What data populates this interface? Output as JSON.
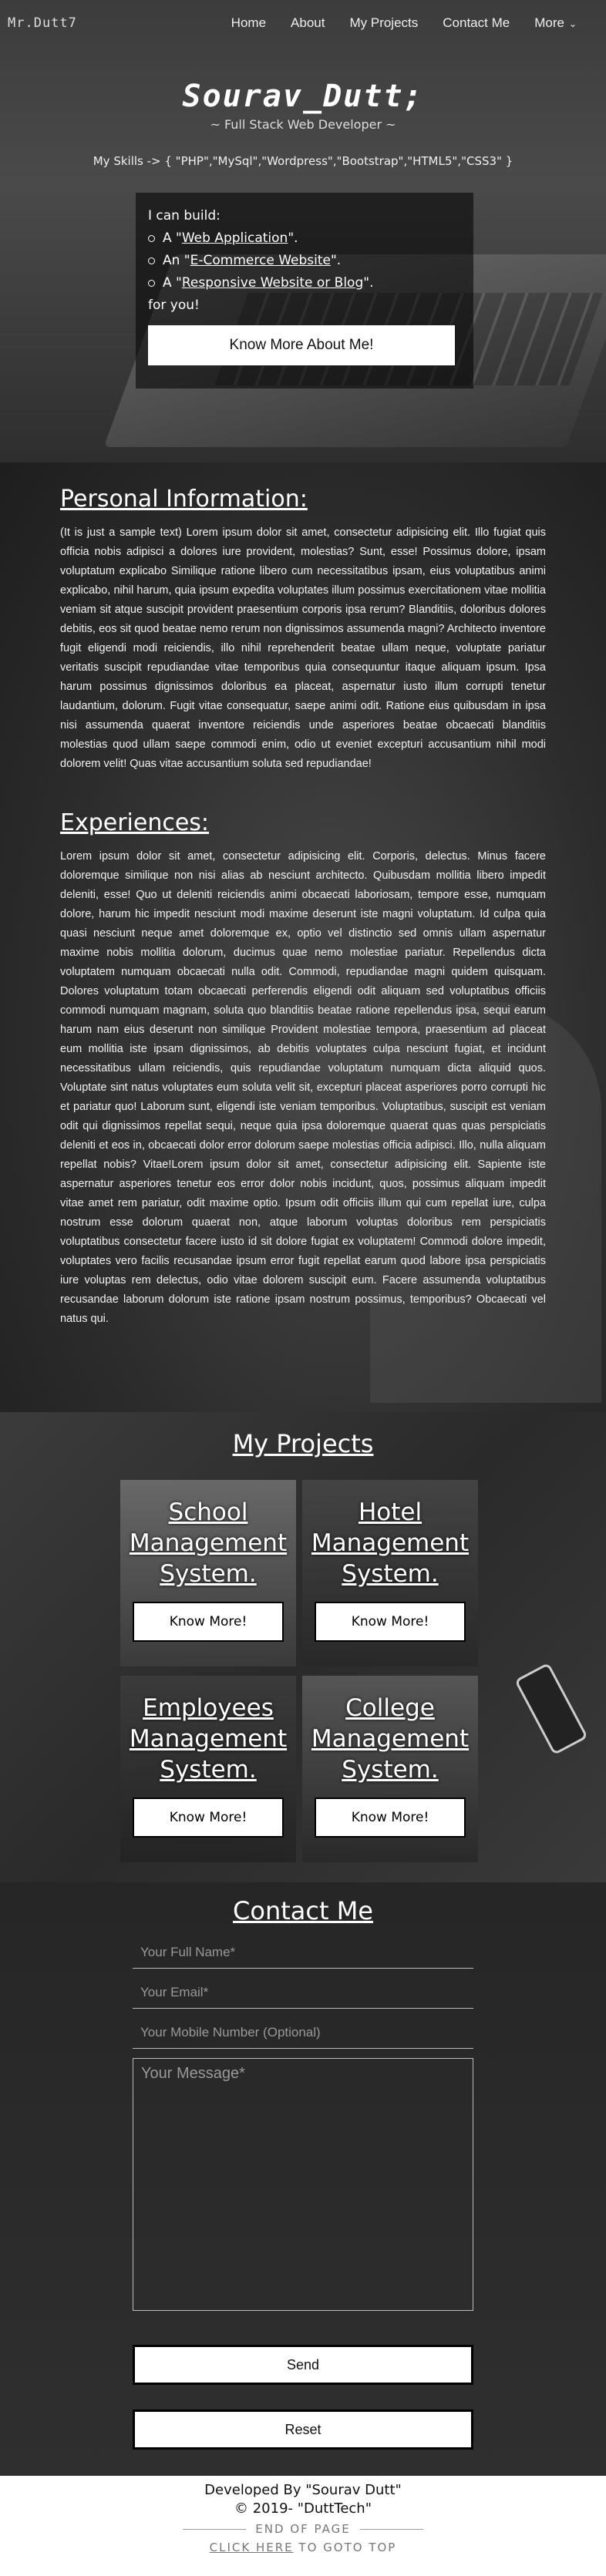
{
  "nav": {
    "brand": "Mr.Dutt7",
    "items": [
      "Home",
      "About",
      "My Projects",
      "Contact Me",
      "More"
    ]
  },
  "hero": {
    "title": "Sourav_Dutt;",
    "subtitle": "~ Full Stack Web Developer ~",
    "skills": "My Skills -> { \"PHP\",\"MySql\",\"Wordpress\",\"Bootstrap\",\"HTML5\",\"CSS3\" }",
    "build_intro": "I can build:",
    "build_items": [
      {
        "prefix": "A \"",
        "link": "Web Application",
        "suffix": "\"."
      },
      {
        "prefix": "An \"",
        "link": "E-Commerce Website",
        "suffix": "\"."
      },
      {
        "prefix": "A \"",
        "link": "Responsive Website or Blog",
        "suffix": "\"."
      }
    ],
    "build_outro": "for you!",
    "button": "Know More About Me!"
  },
  "about": {
    "personal_title": "Personal Information:",
    "personal_text": "(It is just a sample text) Lorem ipsum dolor sit amet, consectetur adipisicing elit. Illo fugiat quis officia nobis adipisci a dolores iure provident, molestias? Sunt, esse! Possimus dolore, ipsam voluptatum explicabo Similique ratione libero cum necessitatibus ipsam, eius voluptatibus animi explicabo, nihil harum, quia ipsum expedita voluptates illum possimus exercitationem vitae mollitia veniam sit atque suscipit provident praesentium corporis ipsa rerum? Blanditiis, doloribus dolores debitis, eos sit quod beatae nemo rerum non dignissimos assumenda magni? Architecto inventore fugit eligendi modi reiciendis, illo nihil reprehenderit beatae ullam neque, voluptate pariatur veritatis suscipit repudiandae vitae temporibus quia consequuntur itaque aliquam ipsum. Ipsa harum possimus dignissimos doloribus ea placeat, aspernatur iusto illum corrupti tenetur laudantium, dolorum. Fugit vitae consequatur, saepe animi odit. Ratione eius quibusdam in ipsa nisi assumenda quaerat inventore reiciendis unde asperiores beatae obcaecati blanditiis molestias quod ullam saepe commodi enim, odio ut eveniet excepturi accusantium nihil modi dolorem velit! Quas vitae accusantium soluta sed repudiandae!",
    "experience_title": "Experiences:",
    "experience_text": "Lorem ipsum dolor sit amet, consectetur adipisicing elit. Corporis, delectus. Minus facere doloremque similique non nisi alias ab nesciunt architecto. Quibusdam mollitia libero impedit deleniti, esse! Quo ut deleniti reiciendis animi obcaecati laboriosam, tempore esse, numquam dolore, harum hic impedit nesciunt modi maxime deserunt iste magni voluptatum. Id culpa quia quasi nesciunt neque amet doloremque ex, optio vel distinctio sed omnis ullam aspernatur maxime nobis mollitia dolorum, ducimus quae nemo molestiae pariatur. Repellendus dicta voluptatem numquam obcaecati nulla odit. Commodi, repudiandae magni quidem quisquam. Dolores voluptatum totam obcaecati perferendis eligendi odit aliquam sed voluptatibus officiis commodi numquam magnam, soluta quo blanditiis beatae ratione repellendus ipsa, sequi earum harum nam eius deserunt non similique Provident molestiae tempora, praesentium ad placeat eum mollitia iste ipsam dignissimos, ab debitis voluptates culpa nesciunt fugiat, et incidunt necessitatibus ullam reiciendis, quis repudiandae voluptatum numquam dicta aliquid quos. Voluptate sint natus voluptates eum soluta velit sit, excepturi placeat asperiores porro corrupti hic et pariatur quo! Laborum sunt, eligendi iste veniam temporibus. Voluptatibus, suscipit est veniam odit qui dignissimos repellat sequi, neque quia ipsa doloremque quaerat quas quas perspiciatis deleniti et eos in, obcaecati dolor error dolorum saepe molestias officia adipisci. Illo, nulla aliquam repellat nobis? Vitae!Lorem ipsum dolor sit amet, consectetur adipisicing elit. Sapiente iste aspernatur asperiores tenetur eos error dolor nobis incidunt, quos, possimus aliquam impedit vitae amet rem pariatur, odit maxime optio. Ipsum odit officiis illum qui cum repellat iure, culpa nostrum esse dolorum quaerat non, atque laborum voluptas doloribus rem perspiciatis voluptatibus consectetur facere iusto id sit dolore fugiat ex voluptatem! Commodi dolore impedit, voluptates vero facilis recusandae ipsum error fugit repellat earum quod labore ipsa perspiciatis iure voluptas rem delectus, odio vitae dolorem suscipit eum. Facere assumenda voluptatibus recusandae laborum dolorum iste ratione ipsam nostrum possimus, temporibus? Obcaecati vel natus qui."
  },
  "projects": {
    "title": "My Projects",
    "cards": [
      {
        "name": "School Management System.",
        "button": "Know More!"
      },
      {
        "name": "Hotel Management System.",
        "button": "Know More!"
      },
      {
        "name": "Employees Management System.",
        "button": "Know More!"
      },
      {
        "name": "College Management System.",
        "button": "Know More!"
      }
    ]
  },
  "contact": {
    "title": "Contact Me",
    "name_placeholder": "Your Full Name*",
    "email_placeholder": "Your Email*",
    "mobile_placeholder": "Your Mobile Number (Optional)",
    "message_placeholder": "Your Message*",
    "send": "Send",
    "reset": "Reset"
  },
  "footer": {
    "developed_by": "Developed By \"Sourav Dutt\"",
    "copyright": "© 2019- \"DuttTech\"",
    "end_of_page": "END OF PAGE",
    "click_here": "CLICK HERE",
    "goto_top": " TO GOTO TOP"
  }
}
